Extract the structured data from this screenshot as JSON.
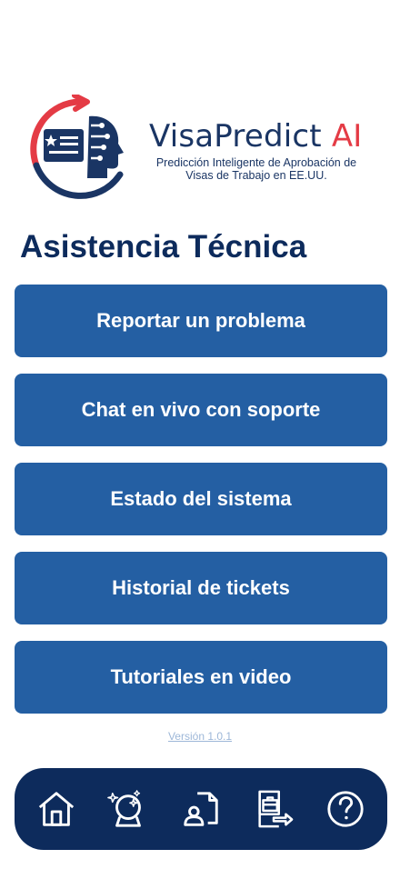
{
  "brand": {
    "name_main": "VisaPredict",
    "name_accent": "AI",
    "tagline": "Predicción Inteligente de Aprobación de Visas de Trabajo en EE.UU.",
    "colors": {
      "primary": "#1a3564",
      "accent": "#e43b45"
    }
  },
  "page": {
    "title": "Asistencia Técnica"
  },
  "menu": {
    "items": [
      {
        "label": "Reportar un problema"
      },
      {
        "label": "Chat en vivo con soporte"
      },
      {
        "label": "Estado del sistema"
      },
      {
        "label": "Historial de tickets"
      },
      {
        "label": "Tutoriales en video"
      }
    ],
    "button_color": "#245fa3"
  },
  "footer": {
    "version": "Versión 1.0.1"
  },
  "bottom_nav": {
    "background": "#0d2b5c",
    "items": [
      {
        "icon": "home-icon"
      },
      {
        "icon": "crystal-ball-icon"
      },
      {
        "icon": "user-document-icon"
      },
      {
        "icon": "briefcase-export-icon"
      },
      {
        "icon": "help-icon"
      }
    ]
  }
}
